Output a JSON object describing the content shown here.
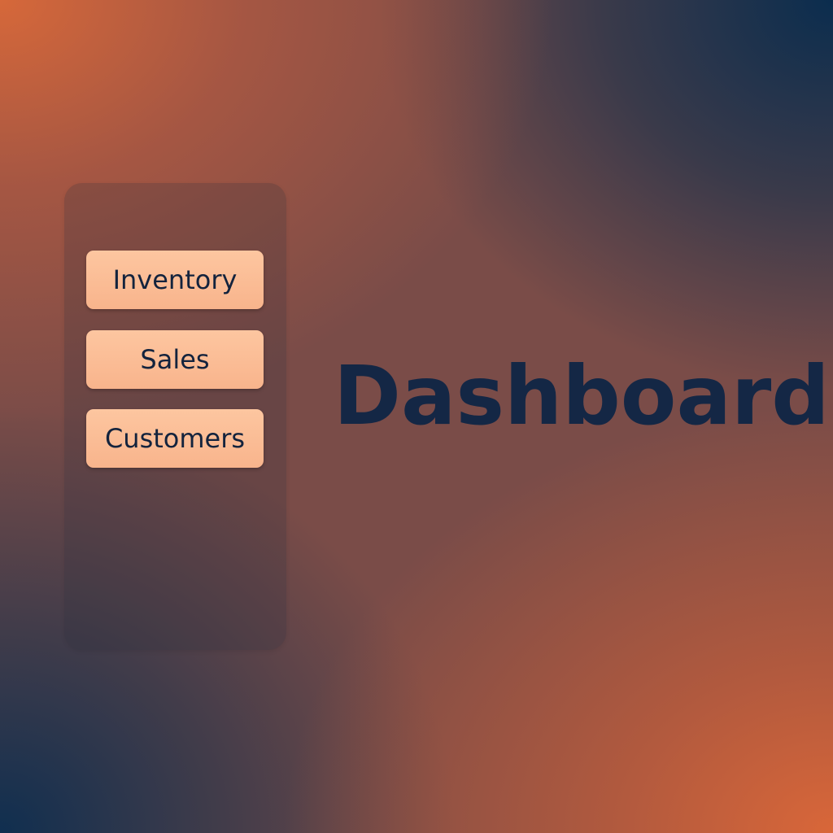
{
  "sidebar": {
    "items": [
      {
        "label": "Inventory"
      },
      {
        "label": "Sales"
      },
      {
        "label": "Customers"
      }
    ]
  },
  "main": {
    "title": "Dashboard"
  },
  "colors": {
    "accent_orange": "#d66a3b",
    "deep_navy": "#0b2a4a",
    "button_fill": "#f8b48c",
    "text_dark": "#13233d"
  }
}
